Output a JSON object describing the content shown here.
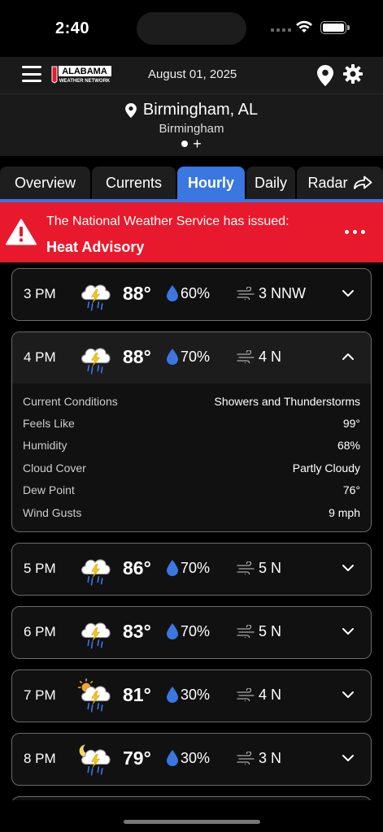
{
  "status_bar": {
    "time": "2:40"
  },
  "header": {
    "logo_text": "ALABAMA",
    "logo_subtext": "WEATHER NETWORK",
    "date": "August 01, 2025",
    "location_title": "Birmingham, AL",
    "location_subtitle": "Birmingham",
    "add_symbol": "+"
  },
  "tabs": [
    {
      "label": "Overview"
    },
    {
      "label": "Currents"
    },
    {
      "label": "Hourly"
    },
    {
      "label": "Daily"
    },
    {
      "label": "Radar"
    }
  ],
  "active_tab": "Hourly",
  "alert": {
    "line1": "The National Weather Service has issued:",
    "line2": "Heat Advisory",
    "color": "#e8192c"
  },
  "hours": [
    {
      "time": "3 PM",
      "icon": "thunderstorm-icon",
      "temp": "88°",
      "precip": "60%",
      "wind": "3 NNW",
      "expanded": false
    },
    {
      "time": "4 PM",
      "icon": "thunderstorm-icon",
      "temp": "88°",
      "precip": "70%",
      "wind": "4 N",
      "expanded": true,
      "details": [
        {
          "label": "Current Conditions",
          "value": "Showers and Thunderstorms"
        },
        {
          "label": "Feels Like",
          "value": "99°"
        },
        {
          "label": "Humidity",
          "value": "68%"
        },
        {
          "label": "Cloud Cover",
          "value": "Partly Cloudy"
        },
        {
          "label": "Dew Point",
          "value": "76°"
        },
        {
          "label": "Wind Gusts",
          "value": "9 mph"
        }
      ]
    },
    {
      "time": "5 PM",
      "icon": "thunderstorm-icon",
      "temp": "86°",
      "precip": "70%",
      "wind": "5 N",
      "expanded": false
    },
    {
      "time": "6 PM",
      "icon": "thunderstorm-icon",
      "temp": "83°",
      "precip": "70%",
      "wind": "5 N",
      "expanded": false
    },
    {
      "time": "7 PM",
      "icon": "sun-thunderstorm-icon",
      "temp": "81°",
      "precip": "30%",
      "wind": "4 N",
      "expanded": false
    },
    {
      "time": "8 PM",
      "icon": "moon-thunderstorm-icon",
      "temp": "79°",
      "precip": "30%",
      "wind": "3 N",
      "expanded": false
    }
  ],
  "colors": {
    "accent": "#3a77e0",
    "alert": "#e8192c",
    "rain_drop": "#3a77e0"
  }
}
